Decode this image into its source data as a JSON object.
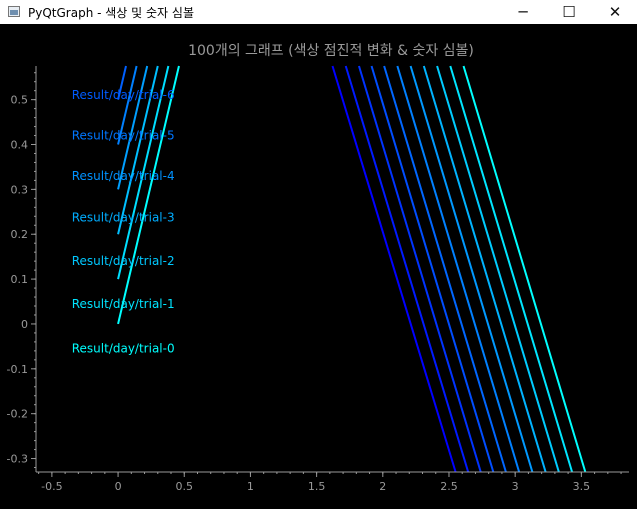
{
  "window": {
    "title": "PyQtGraph - 색상 및 숫자 심볼",
    "minimize_glyph": "─",
    "maximize_glyph": "☐",
    "close_glyph": "✕"
  },
  "colors": {
    "background": "#000000",
    "axis": "#9a9a9a",
    "title_text": "#9a9a9a",
    "gradient_start": "#0000ff",
    "gradient_end": "#00ffff"
  },
  "chart_data": {
    "type": "line",
    "title": "100개의 그래프 (색상 점진적 변화 & 숫자 심볼)",
    "xlabel": "",
    "ylabel": "",
    "xlim": [
      -0.62,
      3.86
    ],
    "ylim": [
      -0.33,
      0.575
    ],
    "x_ticks": [
      -0.5,
      0,
      0.5,
      1,
      1.5,
      2,
      2.5,
      3,
      3.5
    ],
    "x_tick_labels": [
      "-0.5",
      "0",
      "0.5",
      "1",
      "1.5",
      "2",
      "2.5",
      "3",
      "3.5"
    ],
    "y_ticks": [
      -0.3,
      -0.2,
      -0.1,
      0,
      0.1,
      0.2,
      0.3,
      0.4,
      0.5
    ],
    "y_tick_labels": [
      "-0.3",
      "-0.2",
      "-0.1",
      "0",
      "0.1",
      "0.2",
      "0.3",
      "0.4",
      "0.5"
    ],
    "grid": false,
    "legend": "none",
    "series_left": [
      {
        "x": [
          0,
          0.46
        ],
        "y": [
          0,
          0.575
        ]
      },
      {
        "x": [
          0,
          0.38
        ],
        "y": [
          0.1,
          0.575
        ]
      },
      {
        "x": [
          0,
          0.3
        ],
        "y": [
          0.2,
          0.575
        ]
      },
      {
        "x": [
          0,
          0.22
        ],
        "y": [
          0.3,
          0.575
        ]
      },
      {
        "x": [
          0,
          0.14
        ],
        "y": [
          0.4,
          0.575
        ]
      },
      {
        "x": [
          0,
          0.06
        ],
        "y": [
          0.5,
          0.575
        ]
      }
    ],
    "series_right": [
      {
        "x": [
          1.62,
          2.55
        ],
        "y": [
          0.575,
          -0.33
        ]
      },
      {
        "x": [
          1.72,
          2.645
        ],
        "y": [
          0.575,
          -0.33
        ]
      },
      {
        "x": [
          1.82,
          2.74
        ],
        "y": [
          0.575,
          -0.33
        ]
      },
      {
        "x": [
          1.915,
          2.835
        ],
        "y": [
          0.575,
          -0.33
        ]
      },
      {
        "x": [
          2.01,
          2.93
        ],
        "y": [
          0.575,
          -0.33
        ]
      },
      {
        "x": [
          2.11,
          3.03
        ],
        "y": [
          0.575,
          -0.33
        ]
      },
      {
        "x": [
          2.21,
          3.13
        ],
        "y": [
          0.575,
          -0.33
        ]
      },
      {
        "x": [
          2.31,
          3.23
        ],
        "y": [
          0.575,
          -0.33
        ]
      },
      {
        "x": [
          2.41,
          3.33
        ],
        "y": [
          0.575,
          -0.33
        ]
      },
      {
        "x": [
          2.51,
          3.43
        ],
        "y": [
          0.575,
          -0.33
        ]
      },
      {
        "x": [
          2.61,
          3.53
        ],
        "y": [
          0.575,
          -0.33
        ]
      }
    ],
    "annotations": [
      {
        "text": "Result/day/trial-0",
        "x": -0.35,
        "y": -0.055
      },
      {
        "text": "Result/day/trial-1",
        "x": -0.35,
        "y": 0.045
      },
      {
        "text": "Result/day/trial-2",
        "x": -0.35,
        "y": 0.14
      },
      {
        "text": "Result/day/trial-3",
        "x": -0.35,
        "y": 0.237
      },
      {
        "text": "Result/day/trial-4",
        "x": -0.35,
        "y": 0.33
      },
      {
        "text": "Result/day/trial-5",
        "x": -0.35,
        "y": 0.42
      },
      {
        "text": "Result/day/trial-6",
        "x": -0.35,
        "y": 0.51
      }
    ]
  }
}
